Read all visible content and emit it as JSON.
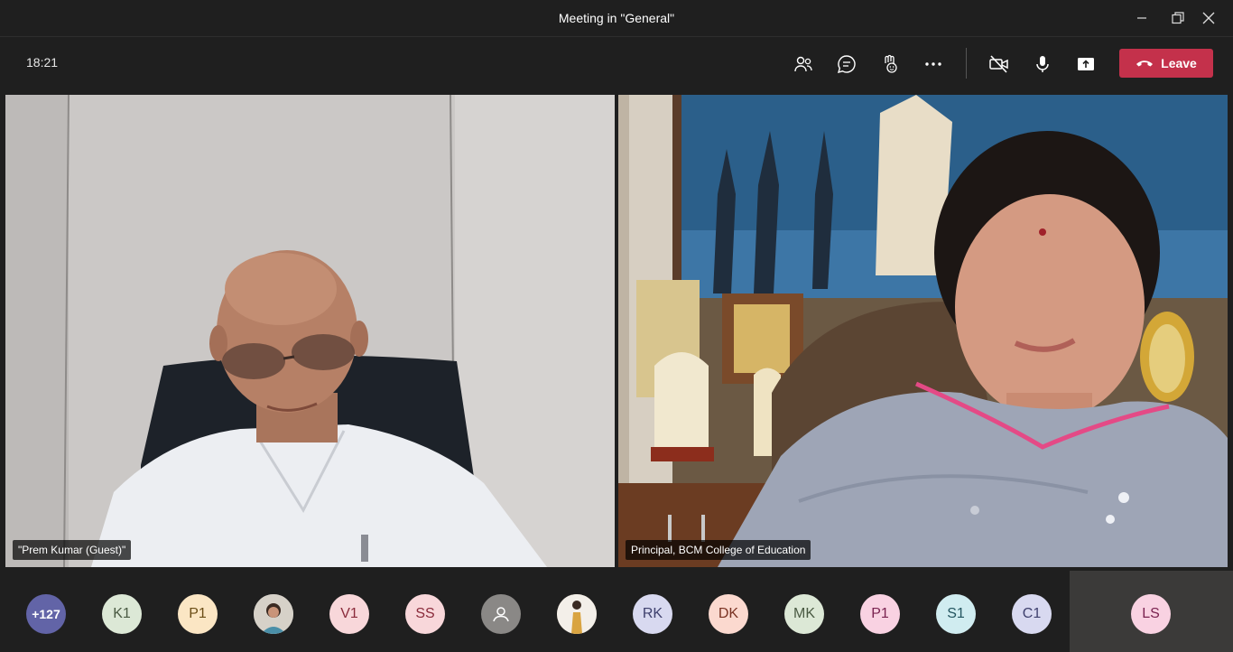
{
  "window": {
    "title": "Meeting in \"General\""
  },
  "toolbar": {
    "timer": "18:21",
    "leave_label": "Leave",
    "icons": [
      "participants-icon",
      "chat-icon",
      "reactions-icon",
      "more-options-icon",
      "camera-off-icon",
      "microphone-icon",
      "share-screen-icon",
      "hangup-icon"
    ]
  },
  "videos": [
    {
      "name": "\"Prem Kumar (Guest)\""
    },
    {
      "name": "Principal, BCM College of Education"
    }
  ],
  "participants": [
    {
      "initials": "+127",
      "bg": "#6264a7",
      "fg": "#ffffff"
    },
    {
      "initials": "K1",
      "bg": "#dce8d6",
      "fg": "#4a5a43"
    },
    {
      "initials": "P1",
      "bg": "#fbe6c4",
      "fg": "#6b4e17"
    },
    {
      "initials": "",
      "bg": "#c9c9c9",
      "fg": "#333333"
    },
    {
      "initials": "V1",
      "bg": "#f8d7da",
      "fg": "#8a2b3b"
    },
    {
      "initials": "SS",
      "bg": "#f8d7da",
      "fg": "#8a2b3b"
    },
    {
      "initials": "",
      "bg": "#8a8886",
      "fg": "#ffffff"
    },
    {
      "initials": "",
      "bg": "#b7a18a",
      "fg": "#333333"
    },
    {
      "initials": "RK",
      "bg": "#d8d9f0",
      "fg": "#3f416e"
    },
    {
      "initials": "DK",
      "bg": "#fbd9cf",
      "fg": "#7a3323"
    },
    {
      "initials": "MK",
      "bg": "#dce8d6",
      "fg": "#4a5a43"
    },
    {
      "initials": "P1",
      "bg": "#f9d2e2",
      "fg": "#7a2350"
    },
    {
      "initials": "S1",
      "bg": "#d0ecf0",
      "fg": "#245560"
    },
    {
      "initials": "C1",
      "bg": "#d8d9f0",
      "fg": "#3f416e"
    },
    {
      "initials": "LS",
      "bg": "#f9d2e2",
      "fg": "#7a2350"
    }
  ]
}
